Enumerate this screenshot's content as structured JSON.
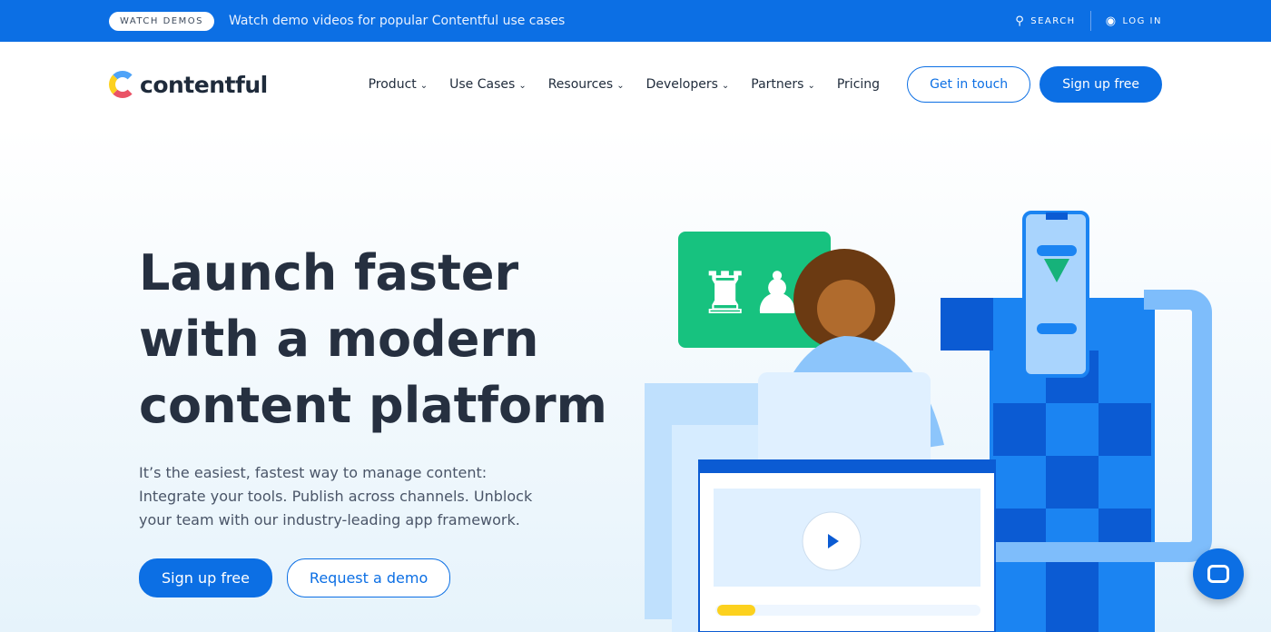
{
  "topbar": {
    "badge": "WATCH DEMOS",
    "message": "Watch demo videos for popular Contentful use cases",
    "search": "SEARCH",
    "login": "LOG IN"
  },
  "nav": {
    "logo": "contentful",
    "items": [
      "Product",
      "Use Cases",
      "Resources",
      "Developers",
      "Partners",
      "Pricing"
    ],
    "get_in_touch": "Get in touch",
    "sign_up": "Sign up free"
  },
  "hero": {
    "title": "Launch faster with a modern content platform",
    "subtitle": "It’s the easiest, fastest way to manage content: Integrate your tools. Publish across channels. Unblock your team with our industry-leading app framework.",
    "primary": "Sign up free",
    "secondary": "Request a demo"
  },
  "colors": {
    "brand": "#0c6fe4",
    "text": "#263040"
  }
}
